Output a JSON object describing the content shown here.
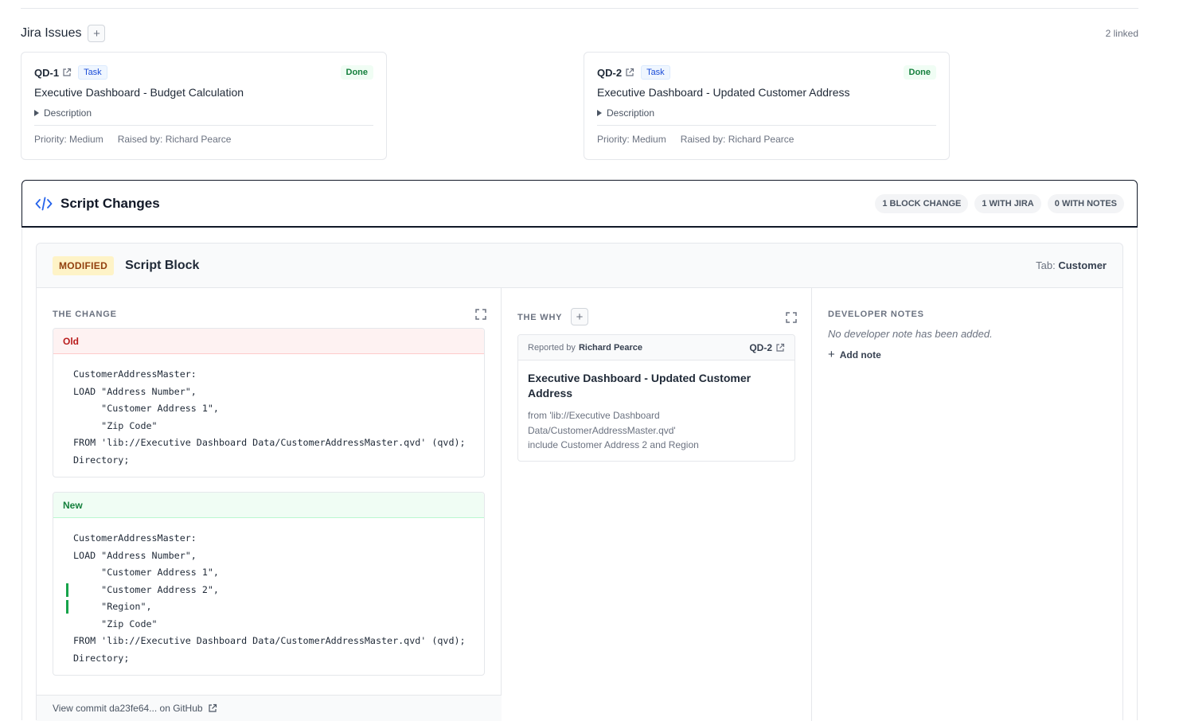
{
  "jira": {
    "title": "Jira Issues",
    "add_label": "+",
    "linked_count": "2 linked",
    "issues": [
      {
        "key": "QD-1",
        "type": "Task",
        "status": "Done",
        "title": "Executive Dashboard - Budget Calculation",
        "description_label": "Description",
        "priority": "Priority: Medium",
        "raised_by": "Raised by: Richard Pearce"
      },
      {
        "key": "QD-2",
        "type": "Task",
        "status": "Done",
        "title": "Executive Dashboard - Updated Customer Address",
        "description_label": "Description",
        "priority": "Priority: Medium",
        "raised_by": "Raised by: Richard Pearce"
      }
    ]
  },
  "script_changes": {
    "title": "Script Changes",
    "pills": [
      "1 BLOCK CHANGE",
      "1 WITH JIRA",
      "0 WITH NOTES"
    ]
  },
  "block": {
    "badge": "MODIFIED",
    "title": "Script Block",
    "tab_label": "Tab:",
    "tab_value": "Customer",
    "change": {
      "label": "THE CHANGE",
      "old_label": "Old",
      "new_label": "New",
      "old_lines": [
        "CustomerAddressMaster:",
        "LOAD \"Address Number\",",
        "     \"Customer Address 1\",",
        "     \"Zip Code\"",
        "FROM 'lib://Executive Dashboard Data/CustomerAddressMaster.qvd' (qvd);",
        "Directory;"
      ],
      "new_lines": [
        "CustomerAddressMaster:",
        "LOAD \"Address Number\",",
        "     \"Customer Address 1\",",
        "     \"Customer Address 2\",",
        "     \"Region\",",
        "     \"Zip Code\"",
        "FROM 'lib://Executive Dashboard Data/CustomerAddressMaster.qvd' (qvd);",
        "Directory;"
      ]
    },
    "why": {
      "label": "THE WHY",
      "add_label": "+",
      "reported_by_label": "Reported by",
      "reported_by": "Richard Pearce",
      "key": "QD-2",
      "title": "Executive Dashboard - Updated Customer Address",
      "body_lines": [
        "from 'lib://Executive Dashboard",
        "Data/CustomerAddressMaster.qvd'",
        "include Customer Address 2 and Region"
      ]
    },
    "notes": {
      "label": "DEVELOPER NOTES",
      "empty_text": "No developer note has been added.",
      "add_label": "Add note"
    },
    "commit_link": "View commit da23fe64... on GitHub"
  },
  "colors": {
    "accent": "#2563eb",
    "added": "#16a34a",
    "removed": "#b91c1c",
    "modified": "#92400e"
  }
}
